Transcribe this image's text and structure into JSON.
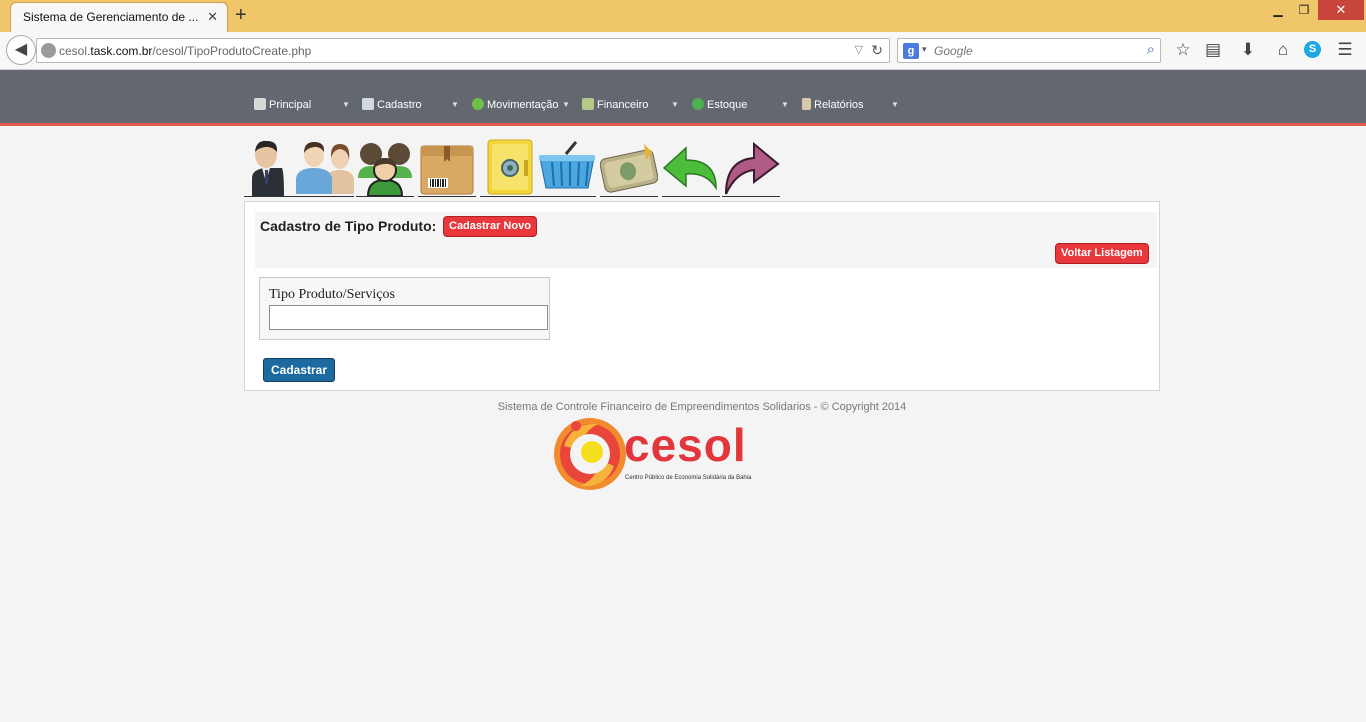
{
  "browser": {
    "tab_title": "Sistema de Gerenciamento de ...",
    "tab_close": "✕",
    "new_tab": "+",
    "url_host_prefix": "cesol.",
    "url_host_main": "task.com.br",
    "url_path": "/cesol/TipoProdutoCreate.php",
    "search_engine_letter": "g",
    "search_placeholder": "Google",
    "window": {
      "minimize": "▁",
      "maximize": "❐",
      "close": "✕"
    }
  },
  "menu": {
    "items": [
      {
        "label": "Principal",
        "icon": "home-icon",
        "color": "#d8d8d8"
      },
      {
        "label": "Cadastro",
        "icon": "id-card-icon",
        "color": "#cfd8e3"
      },
      {
        "label": "Movimentação",
        "icon": "refresh-icon",
        "color": "#6cc04a"
      },
      {
        "label": "Financeiro",
        "icon": "money-icon",
        "color": "#b5c98a"
      },
      {
        "label": "Estoque",
        "icon": "recycle-icon",
        "color": "#4caf50"
      },
      {
        "label": "Relatórios",
        "icon": "clipboard-icon",
        "color": "#d9c9a8"
      }
    ]
  },
  "shortcuts": [
    {
      "name": "businessman-icon"
    },
    {
      "name": "users-icon"
    },
    {
      "name": "group-icon"
    },
    {
      "name": "product-box-icon"
    },
    {
      "name": "safe-icon"
    },
    {
      "name": "shopping-basket-icon"
    },
    {
      "name": "money-icon"
    },
    {
      "name": "undo-arrow-icon"
    },
    {
      "name": "redo-arrow-icon"
    }
  ],
  "form": {
    "title": "Cadastro de Tipo Produto:",
    "new_button": "Cadastrar Novo",
    "back_button": "Voltar Listagem",
    "field_label": "Tipo Produto/Serviços",
    "field_value": "",
    "submit_button": "Cadastrar"
  },
  "footer": {
    "copyright": "Sistema de Controle Financeiro de Empreendimentos Solidarios - © Copyright 2014",
    "logo_word": "cesol",
    "logo_subtitle": "Centro Público de Economia Solidária da Bahia"
  },
  "colors": {
    "menubar": "#636770",
    "accent_red": "#e8383c",
    "submit_blue": "#1c6aa0"
  }
}
